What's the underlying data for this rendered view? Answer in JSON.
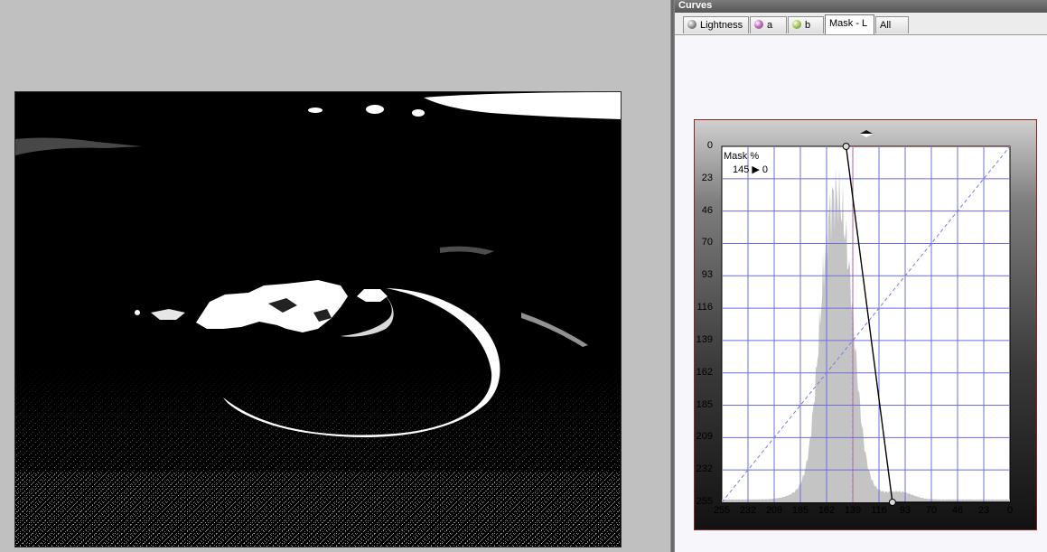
{
  "panel": {
    "title": "Curves"
  },
  "tabs": [
    {
      "label": "Lightness",
      "icon": "lightness-sphere-icon",
      "icon_color": "#6d6d6d",
      "active": false
    },
    {
      "label": "a",
      "icon": "a-channel-sphere-icon",
      "icon_color": "#b34fb1",
      "active": false
    },
    {
      "label": "b",
      "icon": "b-channel-sphere-icon",
      "icon_color": "#8fb833",
      "active": false
    },
    {
      "label": "Mask - L",
      "icon": "",
      "icon_color": "",
      "active": true
    },
    {
      "label": "All",
      "icon": "",
      "icon_color": "",
      "active": false
    }
  ],
  "curve": {
    "mask_label": "Mask %",
    "mask_value": "145 ▶ 0",
    "y_ticks": [
      "0",
      "23",
      "46",
      "70",
      "93",
      "116",
      "139",
      "162",
      "185",
      "209",
      "232",
      "255"
    ],
    "x_ticks": [
      "255",
      "232",
      "209",
      "185",
      "162",
      "139",
      "116",
      "93",
      "70",
      "46",
      "23",
      "0"
    ],
    "input_range": [
      255,
      0
    ],
    "output_range": [
      0,
      255
    ],
    "control_points": [
      {
        "input": 145,
        "output": 0
      },
      {
        "input": 104,
        "output": 255
      }
    ],
    "marker_input": 139,
    "colors": {
      "grid": "#6c6ce0",
      "diagonal": "#7a7ae8",
      "marker": "#e07070",
      "curve": "#000000",
      "histogram": "#c4c4c4"
    }
  }
}
